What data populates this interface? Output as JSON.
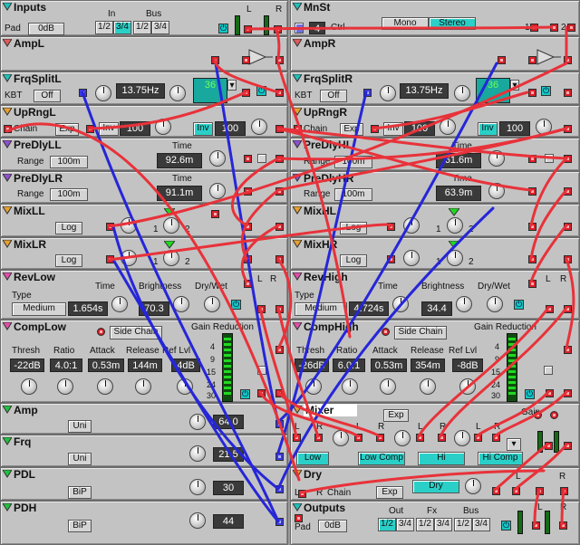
{
  "colors": {
    "panel": "#c3c3c3",
    "cable_red": "#e8323a",
    "cable_blue": "#2626d8",
    "accent": "#2ad0c8",
    "display": "#3a3a3a"
  },
  "inputs": {
    "title": "Inputs",
    "pad_label": "Pad",
    "pad_value": "0dB",
    "in_label": "In",
    "bus_label": "Bus",
    "in_btn1": "1/2",
    "in_btn2": "3/4",
    "bus_btn1": "1/2",
    "bus_btn2": "3/4",
    "l": "L",
    "r": "R"
  },
  "mnst": {
    "title": "MnSt",
    "mono": "Mono",
    "stereo": "Stereo",
    "ctrl_num": "4",
    "ctrl_label": "Ctrl",
    "p1": "1",
    "p2": "2"
  },
  "ampl": {
    "title": "AmpL"
  },
  "ampr": {
    "title": "AmpR"
  },
  "frqsplitl": {
    "title": "FrqSplitL",
    "kbt": "KBT",
    "kbt_value": "Off",
    "freq": "13.75Hz",
    "filter": "36"
  },
  "frqsplitr": {
    "title": "FrqSplitR",
    "kbt": "KBT",
    "kbt_value": "Off",
    "freq": "13.75Hz",
    "filter": "36"
  },
  "uprngl": {
    "title": "UpRngL",
    "chain": "Chain",
    "exp": "Exp",
    "inv": "Inv",
    "v1": "100",
    "v2": "100"
  },
  "uprngr": {
    "title": "UpRngR",
    "chain": "Chain",
    "exp": "Exp",
    "inv": "Inv",
    "v1": "100",
    "v2": "100"
  },
  "predlyll": {
    "title": "PreDlyLL",
    "range": "Range",
    "range_value": "100m",
    "time": "Time",
    "time_value": "92.6m"
  },
  "predlyhl": {
    "title": "PreDlyHL",
    "range": "Range",
    "range_value": "100m",
    "time": "Time",
    "time_value": "61.6m"
  },
  "predlylr": {
    "title": "PreDlyLR",
    "range": "Range",
    "range_value": "100m",
    "time": "Time",
    "time_value": "91.1m"
  },
  "predlyhr": {
    "title": "PreDlyHR",
    "range": "Range",
    "range_value": "100m",
    "time": "Time",
    "time_value": "63.9m"
  },
  "mixll": {
    "title": "MixLL",
    "mode": "Log",
    "p1": "1",
    "p2": "2"
  },
  "mixhl": {
    "title": "MixHL",
    "mode": "Log",
    "p1": "1",
    "p2": "2"
  },
  "mixlr": {
    "title": "MixLR",
    "mode": "Log",
    "p1": "1",
    "p2": "2"
  },
  "mixhr": {
    "title": "MixHR",
    "mode": "Log",
    "p1": "1",
    "p2": "2"
  },
  "revlow": {
    "title": "RevLow",
    "type": "Type",
    "type_value": "Medium",
    "time": "Time",
    "time_value": "1.654s",
    "brightness": "Brightness",
    "brightness_value": "70.3",
    "drywet": "Dry/Wet",
    "l": "L",
    "r": "R"
  },
  "revhigh": {
    "title": "RevHigh",
    "type": "Type",
    "type_value": "Medium",
    "time": "Time",
    "time_value": "4.724s",
    "brightness": "Brightness",
    "brightness_value": "34.4",
    "drywet": "Dry/Wet",
    "l": "L",
    "r": "R"
  },
  "complow": {
    "title": "CompLow",
    "side_chain": "Side Chain",
    "gain_reduction": "Gain Reduction",
    "thresh": "Thresh",
    "thresh_value": "-22dB",
    "ratio": "Ratio",
    "ratio_value": "4.0:1",
    "attack": "Attack",
    "attack_value": "0.53m",
    "release": "Release",
    "release_value": "144m",
    "reflvl": "Ref Lvl",
    "reflvl_value": "4dB",
    "scale": [
      "4",
      "9",
      "15",
      "24",
      "30"
    ]
  },
  "comphigh": {
    "title": "CompHigh",
    "side_chain": "Side Chain",
    "gain_reduction": "Gain Reduction",
    "thresh": "Thresh",
    "thresh_value": "-26dB",
    "ratio": "Ratio",
    "ratio_value": "6.0:1",
    "attack": "Attack",
    "attack_value": "0.53m",
    "release": "Release",
    "release_value": "354m",
    "reflvl": "Ref Lvl",
    "reflvl_value": "-8dB",
    "scale": [
      "4",
      "9",
      "15",
      "24",
      "30"
    ]
  },
  "amp": {
    "title": "Amp",
    "mode": "Uni",
    "value": "64.0"
  },
  "frq": {
    "title": "Frq",
    "mode": "Uni",
    "value": "21.5"
  },
  "pdl": {
    "title": "PDL",
    "mode": "BiP",
    "value": "30"
  },
  "pdh": {
    "title": "PDH",
    "mode": "BiP",
    "value": "44"
  },
  "mixer": {
    "title": "Mixer",
    "exp": "Exp",
    "l": "L",
    "r": "R",
    "gain": "Gain",
    "low": "Low",
    "low_comp": "Low Comp",
    "hi": "Hi",
    "hi_comp": "Hi Comp"
  },
  "dry": {
    "title": "Dry",
    "l": "L",
    "r": "R",
    "chain": "Chain",
    "exp": "Exp",
    "dry": "Dry"
  },
  "outputs": {
    "title": "Outputs",
    "pad_label": "Pad",
    "pad_value": "0dB",
    "out_label": "Out",
    "fx_label": "Fx",
    "bus_label": "Bus",
    "out1": "1/2",
    "out2": "3/4",
    "fx1": "1/2",
    "fx2": "3/4",
    "bus1": "1/2",
    "bus2": "3/4",
    "l": "L",
    "r": "R"
  }
}
